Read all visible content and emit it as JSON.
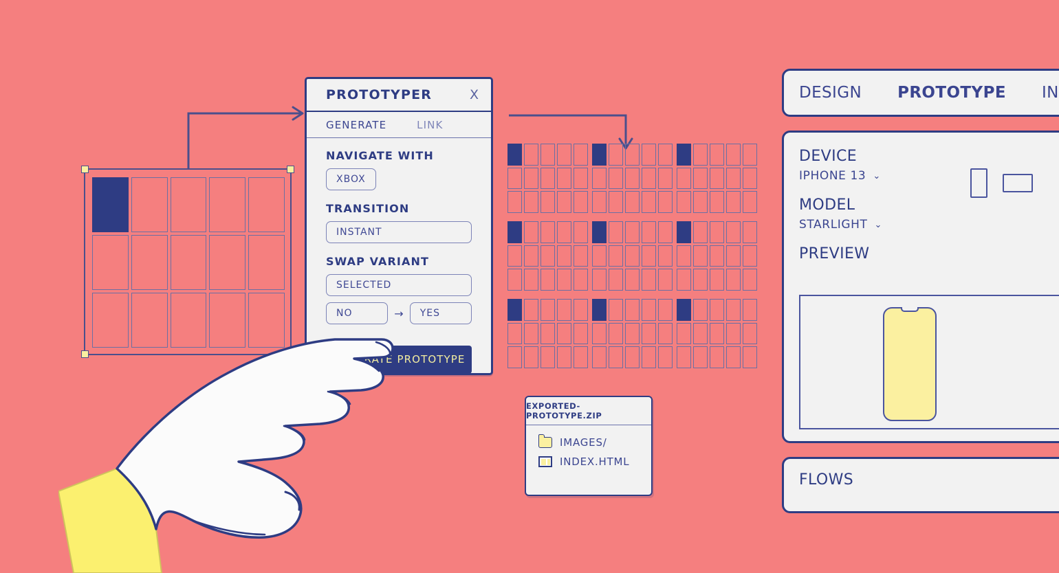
{
  "theme": {
    "background": "#f57f7f",
    "ink": "#2e3c83",
    "panel": "#f2f2f2",
    "accent_yellow": "#fbf0a0",
    "muted_ink": "#7e85b8"
  },
  "canvas": {
    "artboard": {
      "name": "artboard-grid",
      "columns": 5,
      "rows": 3,
      "filled_cell_index": 0,
      "selected": true,
      "handles": [
        "top-left",
        "top-right",
        "bottom-left",
        "bottom-right"
      ]
    },
    "generated_screens": {
      "name": "generated-screens",
      "count": 9,
      "grid_columns": 3,
      "grid_rows": 3,
      "screen_columns": 5,
      "screen_rows": 3,
      "filled_cell_index": 0
    },
    "arrows": [
      {
        "name": "artboard-to-panel-arrow",
        "direction": "right"
      },
      {
        "name": "panel-to-screens-arrow",
        "direction": "down"
      }
    ]
  },
  "prototyper": {
    "title": "PROTOTYPER",
    "close_label": "X",
    "tabs": [
      {
        "label": "GENERATE",
        "active": true
      },
      {
        "label": "LINK",
        "active": false
      }
    ],
    "fields": {
      "navigate_with": {
        "label": "NAVIGATE WITH",
        "value": "XBOX"
      },
      "transition": {
        "label": "TRANSITION",
        "value": "INSTANT"
      },
      "swap_variant": {
        "label": "SWAP VARIANT",
        "value": "SELECTED",
        "from": "NO",
        "arrow": "→",
        "to": "YES"
      }
    },
    "primary_button": "GENERATE PROTOTYPE"
  },
  "zip_card": {
    "title": "EXPORTED-PROTOTYPE.ZIP",
    "entries": [
      {
        "icon": "folder-icon",
        "label": "IMAGES/"
      },
      {
        "icon": "file-icon",
        "label": "INDEX.HTML"
      }
    ]
  },
  "inspector": {
    "tabs": [
      {
        "label": "DESIGN",
        "active": false
      },
      {
        "label": "PROTOTYPE",
        "active": true
      },
      {
        "label": "INSPECT",
        "active": false
      }
    ],
    "device": {
      "label": "DEVICE",
      "value": "IPHONE 13",
      "chevron": "⌄"
    },
    "model": {
      "label": "MODEL",
      "value": "STARLIGHT",
      "chevron": "⌄"
    },
    "orientation": [
      {
        "name": "orientation-portrait",
        "selected": true
      },
      {
        "name": "orientation-landscape",
        "selected": false
      }
    ],
    "preview": {
      "label": "PREVIEW"
    },
    "flows": {
      "label": "FLOWS"
    }
  },
  "hand": {
    "name": "pointing-hand-illustration",
    "sleeve_color": "#fbf06f",
    "skin_color": "#fbfbfb",
    "outline_color": "#2e3c83"
  }
}
